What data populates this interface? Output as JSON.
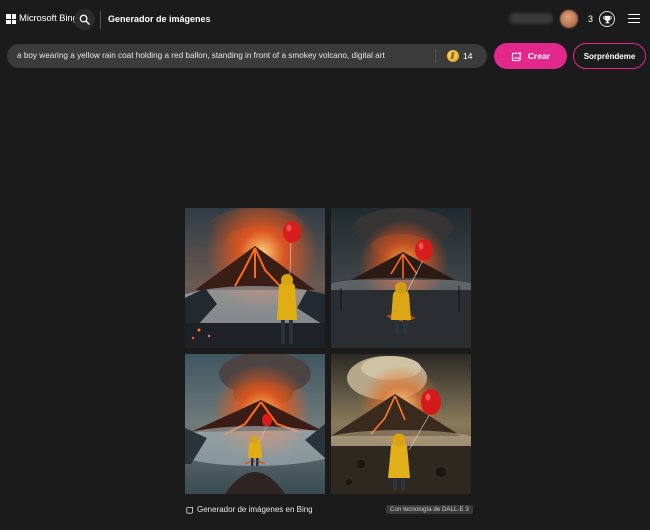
{
  "header": {
    "brand": "Microsoft Bing",
    "page_title": "Generador de imágenes",
    "rewards_count": "3",
    "icons": {
      "logo": "microsoft-logo-icon",
      "search": "search-icon",
      "rewards": "rewards-trophy-icon",
      "menu": "hamburger-menu-icon"
    }
  },
  "prompt": {
    "value": "a boy wearing a yellow rain coat holding a red ballon, standing in front of a smokey volcano, digital art",
    "boosts": "14"
  },
  "actions": {
    "create_label": "Crear",
    "surprise_label": "Sorpréndeme"
  },
  "gallery": {
    "images": [
      {
        "subject": "boy-yellow-raincoat-red-balloon-volcano-1"
      },
      {
        "subject": "boy-yellow-raincoat-red-balloon-volcano-2"
      },
      {
        "subject": "boy-yellow-raincoat-red-balloon-volcano-3"
      },
      {
        "subject": "boy-yellow-raincoat-red-balloon-volcano-4"
      }
    ],
    "caption": "Generador de imágenes en Bing",
    "badge": "Con tecnología de DALL·E 3"
  },
  "colors": {
    "background": "#1c1b1b",
    "accent": "#e3288b",
    "input_bg": "#3b3b3b"
  }
}
